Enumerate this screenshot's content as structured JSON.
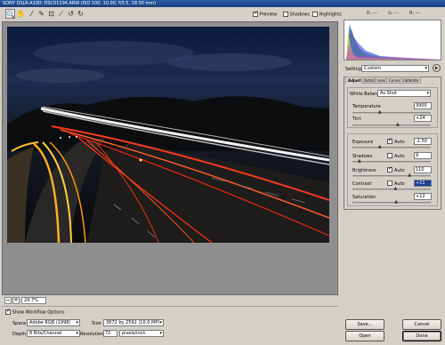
{
  "window": {
    "title": "SONY DSLR-A100: DSC01194.ARW (ISO 100, 10.00, f/3.5, 18.00 mm)"
  },
  "toolbar": {
    "tools": [
      {
        "name": "zoom-tool-icon",
        "glyph": "🔍"
      },
      {
        "name": "hand-tool-icon",
        "glyph": "✋"
      },
      {
        "name": "white-balance-tool-icon",
        "glyph": "⁄"
      },
      {
        "name": "color-sampler-tool-icon",
        "glyph": "✎"
      },
      {
        "name": "crop-tool-icon",
        "glyph": "⊡"
      },
      {
        "name": "straighten-tool-icon",
        "glyph": "⟋"
      },
      {
        "name": "rotate-left-icon",
        "glyph": "↺"
      },
      {
        "name": "rotate-right-icon",
        "glyph": "↻"
      }
    ],
    "preview_label": "Preview",
    "preview_checked": true,
    "shadows_label": "Shadows",
    "shadows_checked": false,
    "highlights_label": "Highlights",
    "highlights_checked": false
  },
  "histogram": {
    "r_label": "R: ---",
    "g_label": "G: ---",
    "b_label": "B: ---",
    "colors": [
      "#ff2a2a",
      "#2aff2a",
      "#2a2aff",
      "#ffff3a",
      "#c04ac0"
    ]
  },
  "settings": {
    "label": "Settings:",
    "value": "Custom"
  },
  "tabs": [
    {
      "label": "Adjust",
      "active": true
    },
    {
      "label": "Detail",
      "active": false
    },
    {
      "label": "Lens",
      "active": false
    },
    {
      "label": "Curve",
      "active": false
    },
    {
      "label": "Calibrate",
      "active": false
    }
  ],
  "adjust": {
    "white_balance_label": "White Balance:",
    "white_balance_value": "As Shot",
    "temperature_label": "Temperature",
    "temperature_value": "3900",
    "temperature_level": 0.35,
    "tint_label": "Tint",
    "tint_value": "+24",
    "tint_level": 0.58,
    "exposure_label": "Exposure",
    "exposure_auto_label": "Auto",
    "exposure_auto": true,
    "exposure_value": "-1.50",
    "exposure_level": 0.35,
    "shadows_label": "Shadows",
    "shadows_auto_label": "Auto",
    "shadows_auto": false,
    "shadows_value": "9",
    "shadows_level": 0.09,
    "brightness_label": "Brightness",
    "brightness_auto_label": "Auto",
    "brightness_auto": true,
    "brightness_value": "110",
    "brightness_level": 0.73,
    "contrast_label": "Contrast",
    "contrast_auto_label": "Auto",
    "contrast_auto": false,
    "contrast_value": "+11",
    "contrast_level": 0.55,
    "saturation_label": "Saturation",
    "saturation_value": "+12",
    "saturation_level": 0.56
  },
  "zoom": {
    "minus": "−",
    "plus": "+",
    "value": "24.7%"
  },
  "workflow": {
    "show_label": "Show Workflow Options",
    "show_checked": true,
    "space_label": "Space:",
    "space_value": "Adobe RGB (1998)",
    "depth_label": "Depth:",
    "depth_value": "8 Bits/Channel",
    "size_label": "Size:",
    "size_value": "3872 by 2592 (10.0 MP)",
    "resolution_label": "Resolution:",
    "resolution_value": "72",
    "resolution_unit": "pixels/inch"
  },
  "buttons": {
    "save": "Save...",
    "cancel": "Cancel",
    "open": "Open",
    "done": "Done"
  }
}
